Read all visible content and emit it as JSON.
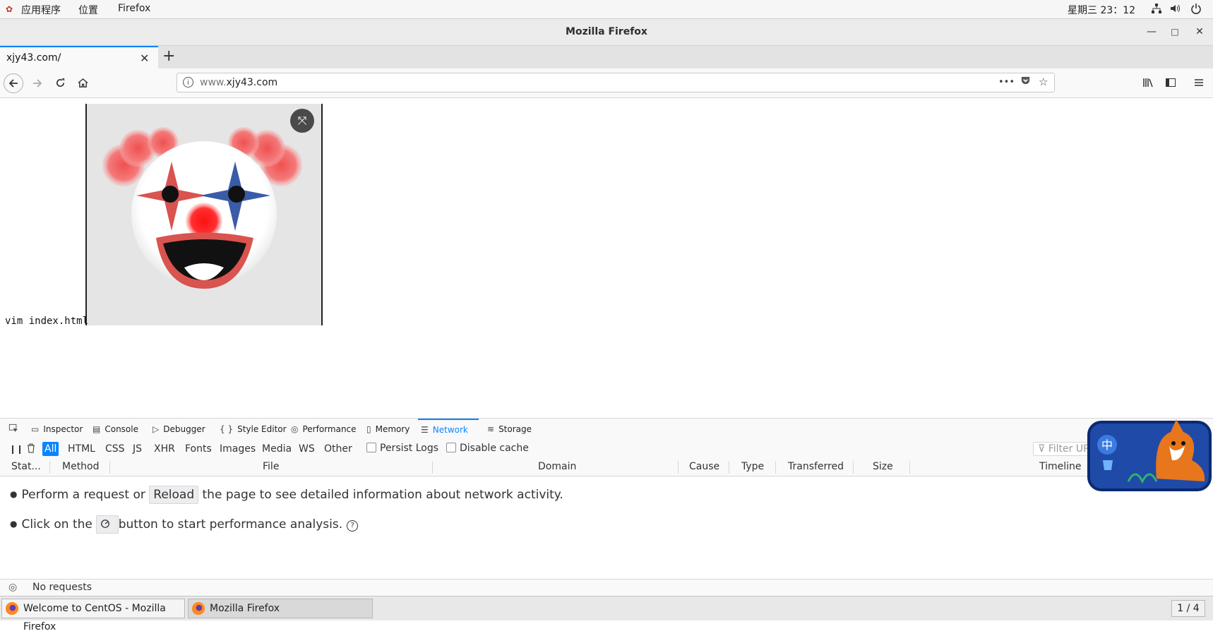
{
  "topbar": {
    "menu_apps": "应用程序",
    "menu_places": "位置",
    "menu_firefox": "Firefox",
    "clock": "星期三 23：12"
  },
  "window": {
    "title": "Mozilla Firefox",
    "minimize": "—",
    "maximize": "□",
    "close": "✕"
  },
  "tabs": [
    {
      "label": "xjy43.com/",
      "close": "✕"
    }
  ],
  "newtab": "+",
  "navbar": {
    "url_prefix": "www.",
    "url_domain": "xjy43.com",
    "page_actions": "•••"
  },
  "content": {
    "vim_text": "vim index.html",
    "fit_button": "⤧"
  },
  "devtools": {
    "tabs": [
      {
        "label": "Inspector",
        "icon": "inspector-icon"
      },
      {
        "label": "Console",
        "icon": "console-icon"
      },
      {
        "label": "Debugger",
        "icon": "debugger-icon"
      },
      {
        "label": "Style Editor",
        "icon": "style-editor-icon"
      },
      {
        "label": "Performance",
        "icon": "performance-icon"
      },
      {
        "label": "Memory",
        "icon": "memory-icon"
      },
      {
        "label": "Network",
        "icon": "network-icon",
        "active": true
      },
      {
        "label": "Storage",
        "icon": "storage-icon"
      }
    ],
    "filters": [
      "All",
      "HTML",
      "CSS",
      "JS",
      "XHR",
      "Fonts",
      "Images",
      "Media",
      "WS",
      "Other"
    ],
    "active_filter": "All",
    "persist_logs": "Persist Logs",
    "disable_cache": "Disable cache",
    "filter_placeholder": "Filter UR",
    "columns": [
      "Stat...",
      "Method",
      "File",
      "Domain",
      "Cause",
      "Type",
      "Transferred",
      "Size",
      "Timeline"
    ],
    "msg1_pre": "Perform a request or",
    "msg1_btn": "Reload",
    "msg1_post": "the page to see detailed information about network activity.",
    "msg2_pre": "Click on the",
    "msg2_post": "button to start performance analysis.",
    "status": "No requests",
    "accent": "#0a84ff"
  },
  "taskbar": {
    "tasks": [
      "Welcome to CentOS - Mozilla Firefox",
      "Mozilla Firefox"
    ],
    "pager": "1 / 4"
  }
}
